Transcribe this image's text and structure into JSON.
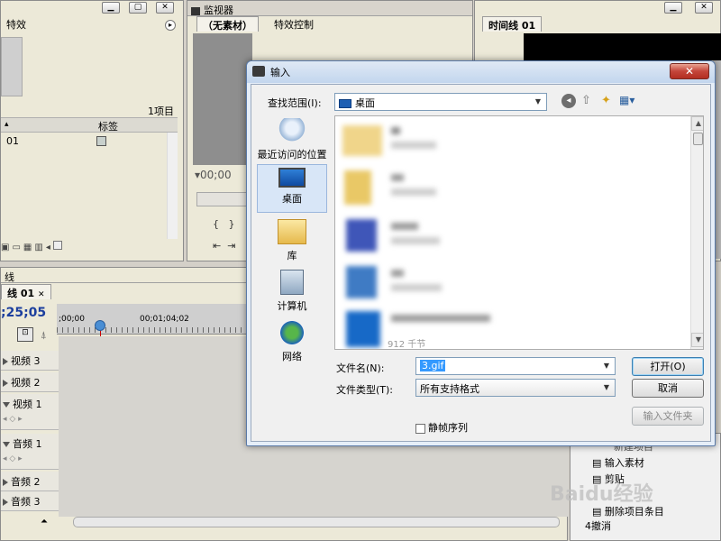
{
  "effects_panel": {
    "title": "",
    "tab": "特效",
    "item_count": "1项目",
    "column_label": "标签",
    "row_name": "01"
  },
  "monitor_panel": {
    "title": "监视器",
    "tabs": [
      "（无素材）",
      "特效控制"
    ],
    "timecode": "00;00"
  },
  "timeline_tab_panel": {
    "tab": "时间线 01"
  },
  "timeline": {
    "panel_title": "线",
    "tab": "线 01",
    "timecode": ";25;05",
    "ruler_labels": [
      ";00;00",
      "00;01;04;02"
    ],
    "tracks": [
      "视频 3",
      "视频 2",
      "视频 1",
      "音频 1",
      "音频 2",
      "音频 3"
    ]
  },
  "context_menu": {
    "items": [
      "输入素材",
      "剪贴",
      "删除项目条目"
    ],
    "partial_top": "新建项目",
    "bottom_text": "4撤消"
  },
  "dialog": {
    "title": "输入",
    "look_in_label": "查找范围(I):",
    "look_in_value": "桌面",
    "places": [
      "最近访问的位置",
      "桌面",
      "库",
      "计算机",
      "网络"
    ],
    "file_name_label": "文件名(N):",
    "file_name_value": "3.gif",
    "file_type_label": "文件类型(T):",
    "file_type_value": "所有支持格式",
    "open_button": "打开(O)",
    "cancel_button": "取消",
    "import_folder_button": "输入文件夹",
    "still_sequence_label": "静帧序列",
    "partial_file_label": "912 千节"
  },
  "watermark": "Baidu经验",
  "colors": {
    "accent": "#3c7fb1",
    "dialog_bg": "#f0f0f0",
    "timeline_needle": "#cc0000"
  }
}
